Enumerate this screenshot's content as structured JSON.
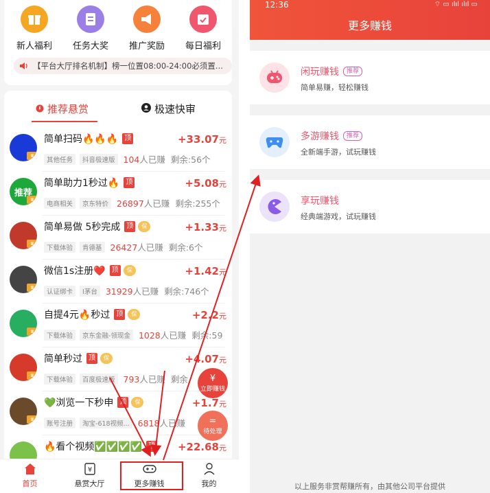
{
  "left": {
    "quick_actions": [
      {
        "label": "新人福利",
        "color": "#f5a623"
      },
      {
        "label": "任务大奖",
        "color": "#9b7ee6"
      },
      {
        "label": "推广奖励",
        "color": "#f5813a"
      },
      {
        "label": "每日福利",
        "color": "#f0566e"
      }
    ],
    "marquee_text": "【平台大厅排名机制】榜一位置08:00-24:00必须置...",
    "tabs": {
      "recommended": "推荐悬赏",
      "fast": "极速快审"
    },
    "tasks": [
      {
        "title": "简单扫码🔥🔥🔥",
        "ding": "顶",
        "bao": "",
        "tags": [
          "其他任务",
          "抖音极速版"
        ],
        "earned_num": "104",
        "earned_suffix": "人已赚",
        "remain": "剩余:56个",
        "price_sign": "+",
        "price": "33.07",
        "unit": "元",
        "avatar": "#1a3ad8"
      },
      {
        "title": "简单助力1秒过🔥",
        "ding": "顶",
        "bao": "",
        "tags": [
          "电商相关",
          "京东特价"
        ],
        "earned_num": "26897",
        "earned_suffix": "人已赚",
        "remain": "剩余:255个",
        "price_sign": "+",
        "price": "5.08",
        "unit": "元",
        "avatar": "#1fa83a",
        "avatar_text": "推荐"
      },
      {
        "title": "简单易做 5秒完成",
        "ding": "顶",
        "bao": "保",
        "tags": [
          "下载体验",
          "肯德基"
        ],
        "earned_num": "26427",
        "earned_suffix": "人已赚",
        "remain": "剩余:6个",
        "price_sign": "+",
        "price": "1.33",
        "unit": "元",
        "avatar": "#c0392b"
      },
      {
        "title": "微信1s注册❤️",
        "ding": "顶",
        "bao": "保",
        "tags": [
          "认证绑卡",
          "I茅台"
        ],
        "earned_num": "31929",
        "earned_suffix": "人已赚",
        "remain": "剩余:746个",
        "price_sign": "+",
        "price": "1.42",
        "unit": "元",
        "avatar": "#444444"
      },
      {
        "title": "自提4元🔥秒过",
        "ding": "顶",
        "bao": "保",
        "tags": [
          "下载体验",
          "京东金融-领现金"
        ],
        "earned_num": "1028",
        "earned_suffix": "人已赚",
        "remain": "剩余:59",
        "price_sign": "+",
        "price": "2.2",
        "unit": "元",
        "avatar": "#27ae60"
      },
      {
        "title": "简单秒过",
        "ding": "顶",
        "bao": "保",
        "tags": [
          "下载体验",
          "百度极速版"
        ],
        "earned_num": "793",
        "earned_suffix": "人已赚",
        "remain": "剩余",
        "price_sign": "+",
        "price": "4.07",
        "unit": "元",
        "avatar": "#d63a2a"
      },
      {
        "title": "💚浏览一下秒申",
        "ding": "顶",
        "bao": "保",
        "tags": [
          "账号注册",
          "淘宝-618视频..."
        ],
        "earned_num": "6818",
        "earned_suffix": "人已赚",
        "remain": "",
        "price_sign": "+",
        "price": "1.7",
        "unit": "元",
        "avatar": "#6b4a2b"
      },
      {
        "title": "🔥看个视频✅✅✅✅",
        "ding": "顶",
        "bao": "",
        "tags": [],
        "earned_num": "",
        "earned_suffix": "",
        "remain": "",
        "price_sign": "+",
        "price": "22.68",
        "unit": "元",
        "avatar": "#7cc24a"
      }
    ],
    "float_buttons": [
      {
        "icon": "¥",
        "label": "立即赚钱"
      },
      {
        "icon": "=",
        "label": "待处理"
      }
    ],
    "nav": [
      {
        "label": "首页"
      },
      {
        "label": "悬赏大厅"
      },
      {
        "label": "更多赚钱"
      },
      {
        "label": "我的"
      }
    ]
  },
  "right": {
    "status_time": "12:36",
    "status_icons": "⌔ ▭ ılıl ılıl ▭",
    "title": "更多赚钱",
    "games": [
      {
        "name": "闲玩赚钱",
        "badge": "推荐",
        "desc": "简单易赚，轻松赚钱",
        "icon_bg": "#fde3e7",
        "icon_color": "#f0566e"
      },
      {
        "name": "多游赚钱",
        "badge": "推荐",
        "desc": "全新端手游，试玩赚钱",
        "icon_bg": "#e3effd",
        "icon_color": "#3c8ef0"
      },
      {
        "name": "享玩赚钱",
        "badge": "",
        "desc": "经典端游戏，试玩赚钱",
        "icon_bg": "#ece3fb",
        "icon_color": "#8a5ce6"
      }
    ],
    "footer": "以上服务非赏帮赚所有，由其他公司平台提供"
  },
  "colors": {
    "accent": "#e8433b",
    "annotation": "#e02020"
  }
}
